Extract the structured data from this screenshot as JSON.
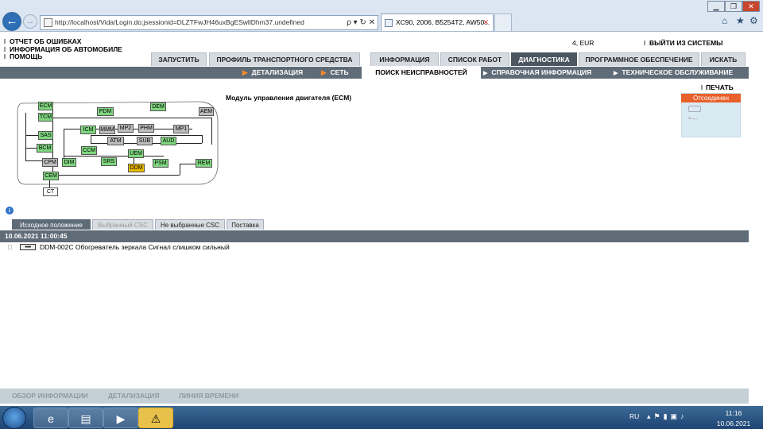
{
  "browser": {
    "url": "http://localhost/Vida/Login.do;jsessionid=DLZTFwJH46uxBgESwllDhm37.undefined",
    "url_controls": "ρ ▾ ↻ ✕",
    "tab_title": "XC90, 2006, B5254T2, AW50...",
    "tab_close": "✕",
    "window_min": "▁",
    "window_max": "❐",
    "window_close": "✕",
    "home_icon": "⌂",
    "favorites_icon": "★",
    "tools_icon": "⚙"
  },
  "topmenu": {
    "items": [
      "ОТЧЕТ ОБ ОШИБКАХ",
      "ИНФОРМАЦИЯ ОБ АВТОМОБИЛЕ",
      "ПОМОЩЬ"
    ],
    "account": "4, EUR",
    "logout": "ВЫЙТИ ИЗ СИСТЕМЫ"
  },
  "main_tabs": [
    "ЗАПУСТИТЬ",
    "ПРОФИЛЬ ТРАНСПОРТНОГО СРЕДСТВА",
    "ИНФОРМАЦИЯ",
    "СПИСОК РАБОТ",
    "ДИАГНОСТИКА",
    "ПРОГРАММНОЕ ОБЕСПЕЧЕНИЕ",
    "ИСКАТЬ"
  ],
  "active_tab": "ДИАГНОСТИКА",
  "sub_tabs": [
    "ДЕТАЛИЗАЦИЯ",
    "СЕТЬ",
    "ПОИСК НЕИСПРАВНОСТЕЙ",
    "СПРАВОЧНАЯ ИНФОРМАЦИЯ",
    "ТЕХНИЧЕСКОЕ ОБСЛУЖИВАНИЕ"
  ],
  "active_sub_tab": "ПОИСК НЕИСПРАВНОСТЕЙ",
  "diagram": {
    "title": "Модуль управления двигателя (ECM)",
    "print": "ПЕЧАТЬ",
    "status": "Отсоединен",
    "status_color": "#e8602a",
    "modules": {
      "ecm": "ECM",
      "tcm": "TCM",
      "sas": "SAS",
      "bcm": "BCM",
      "cpm": "CPM",
      "dim": "DIM",
      "cem": "CEM",
      "ct": "CT",
      "pdm": "PDM",
      "dem": "DEM",
      "aem": "AEM",
      "icm": "ICM",
      "mmm": "MMM",
      "mp2": "MP2",
      "phm": "PHM",
      "mp1": "MP1",
      "atm": "ATM",
      "sub": "SUB",
      "aud": "AUD",
      "ccm": "CCM",
      "uem": "UEM",
      "srs": "SRS",
      "ddm": "DDM",
      "psm": "PSM",
      "rem": "REM"
    },
    "module_status_colors": {
      "ok": "#7fd67f",
      "fault": "#e6b800",
      "no_response": "#bdbdbd"
    }
  },
  "fault_tabs": [
    "Исходное положение",
    "Выбранный CSC",
    "Не выбранные CSC",
    "Поставка"
  ],
  "fault_list": {
    "date": "10.06.2021 11:00:45",
    "rows": [
      {
        "code": "DDM-002C Обогреватель зеркала Сигнал слишком сильный"
      }
    ]
  },
  "bottom_tabs": [
    "ОБЗОР ИНФОРМАЦИИ",
    "ДЕТАЛИЗАЦИЯ",
    "ЛИНИЯ ВРЕМЕНИ"
  ],
  "taskbar": {
    "language": "RU",
    "time": "11:16",
    "date": "10.06.2021"
  }
}
